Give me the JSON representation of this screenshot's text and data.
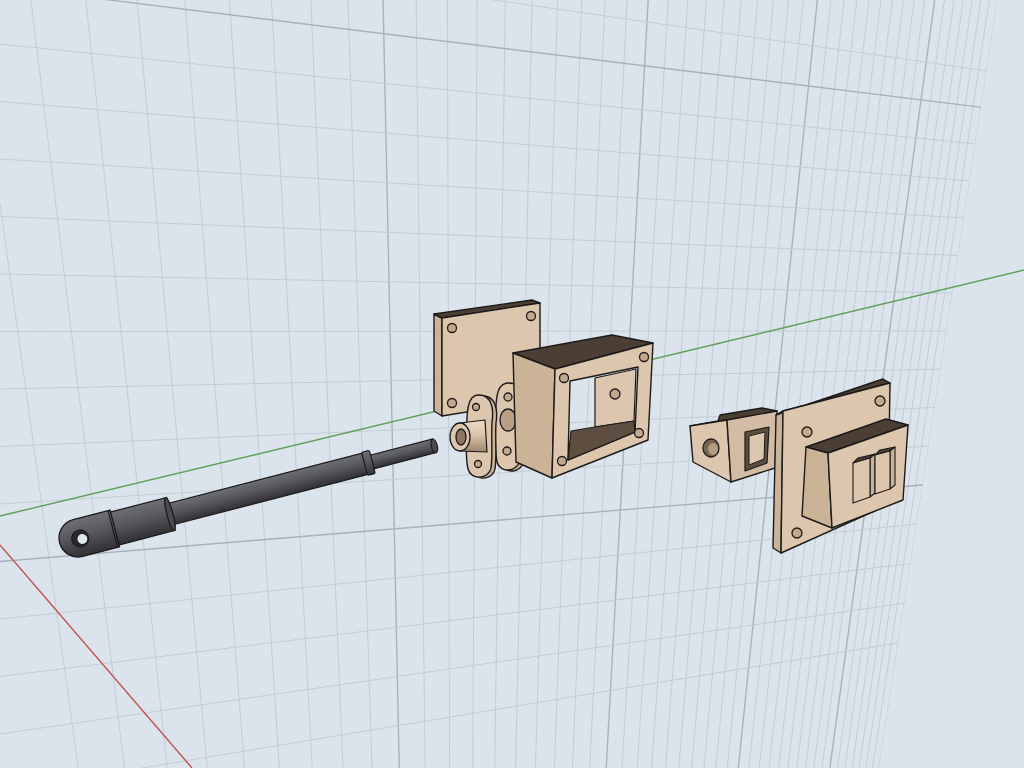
{
  "viewport": {
    "axes": [
      {
        "kind": "y-axis",
        "color": "#5e9f5a"
      },
      {
        "kind": "x-axis",
        "color": "#c0504d"
      }
    ],
    "parts": [
      {
        "kind": "rod"
      },
      {
        "kind": "plate"
      },
      {
        "kind": "flange"
      },
      {
        "kind": "housing"
      },
      {
        "kind": "clip"
      },
      {
        "kind": "bracket"
      }
    ]
  }
}
